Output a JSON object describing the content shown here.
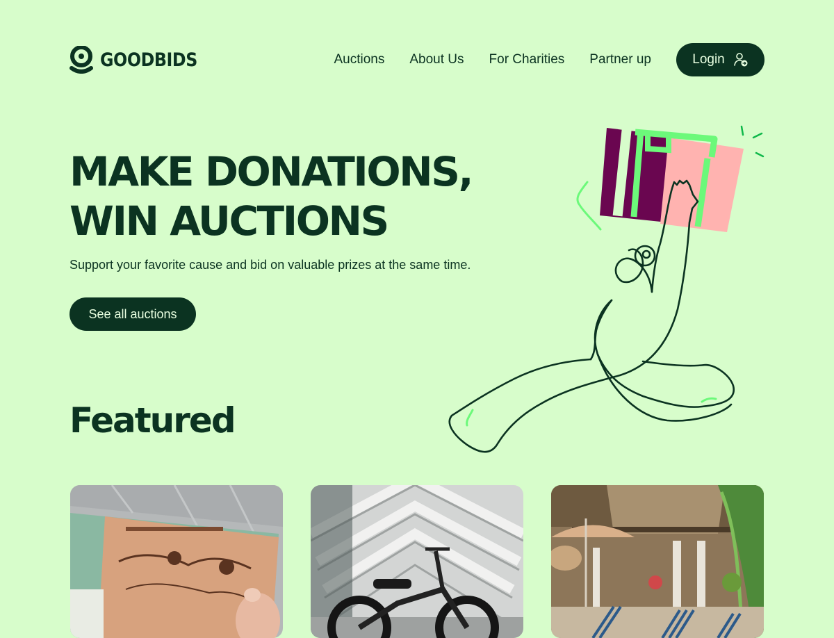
{
  "brand": {
    "name": "GOODBIDS",
    "logo_icon": "goodbids-logo-icon"
  },
  "nav": {
    "items": [
      "Auctions",
      "About Us",
      "For Charities",
      "Partner up"
    ],
    "login_label": "Login",
    "login_icon": "user-login-icon"
  },
  "hero": {
    "title_line1": "MAKE DONATIONS,",
    "title_line2": "WIN AUCTIONS",
    "subtitle": "Support your favorite cause and bid on valuable prizes at the same time.",
    "cta_label": "See all auctions",
    "illustration": "person-reaching-for-gift-illustration"
  },
  "featured": {
    "title": "Featured",
    "cards": [
      {
        "image": "disney-exhibition-tickets-photo"
      },
      {
        "image": "electric-bike-photo"
      },
      {
        "image": "resort-pool-loungers-photo"
      }
    ]
  },
  "colors": {
    "background": "#d7fdcb",
    "primary": "#0b3321",
    "accent_green": "#6cf97a",
    "gift_purple": "#6a0650",
    "gift_pink": "#ffb3b0"
  }
}
